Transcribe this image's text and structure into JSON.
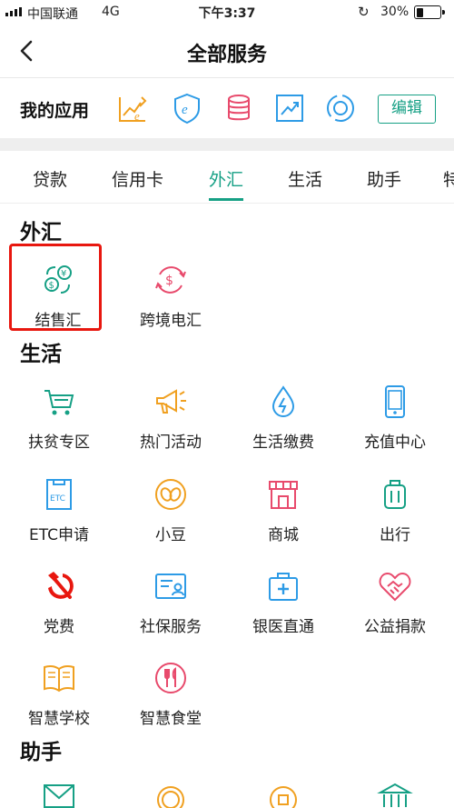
{
  "status_bar": {
    "carrier": "中国联通",
    "network": "4G",
    "time": "下午3:37",
    "battery": "30%",
    "battery_level": 0.3
  },
  "header": {
    "title": "全部服务"
  },
  "my_apps": {
    "label": "我的应用",
    "edit_label": "编辑",
    "icons": [
      "chart-pen-icon",
      "e-shield-icon",
      "coin-stack-icon",
      "trend-chart-icon",
      "sync-circle-icon"
    ]
  },
  "tabs": [
    {
      "label": "贷款"
    },
    {
      "label": "信用卡"
    },
    {
      "label": "外汇"
    },
    {
      "label": "生活"
    },
    {
      "label": "助手"
    },
    {
      "label": "特"
    }
  ],
  "sections": {
    "forex": {
      "title": "外汇",
      "items": [
        {
          "label": "结售汇",
          "icon": "currency-exchange-icon"
        },
        {
          "label": "跨境电汇",
          "icon": "dollar-transfer-icon"
        }
      ]
    },
    "life": {
      "title": "生活",
      "items": [
        {
          "label": "扶贫专区",
          "icon": "shopping-cart-icon"
        },
        {
          "label": "热门活动",
          "icon": "megaphone-icon"
        },
        {
          "label": "生活缴费",
          "icon": "water-drop-icon"
        },
        {
          "label": "充值中心",
          "icon": "mobile-phone-icon"
        },
        {
          "label": "ETC申请",
          "icon": "etc-card-icon"
        },
        {
          "label": "小豆",
          "icon": "bean-icon"
        },
        {
          "label": "商城",
          "icon": "store-icon"
        },
        {
          "label": "出行",
          "icon": "luggage-icon"
        },
        {
          "label": "党费",
          "icon": "hammer-sickle-icon"
        },
        {
          "label": "社保服务",
          "icon": "id-card-icon"
        },
        {
          "label": "银医直通",
          "icon": "medical-kit-icon"
        },
        {
          "label": "公益捐款",
          "icon": "handshake-heart-icon"
        },
        {
          "label": "智慧学校",
          "icon": "open-book-icon"
        },
        {
          "label": "智慧食堂",
          "icon": "fork-knife-icon"
        }
      ]
    },
    "assistant": {
      "title": "助手"
    }
  },
  "colors": {
    "accent": "#16a085",
    "highlight_box": "#e8170f"
  }
}
